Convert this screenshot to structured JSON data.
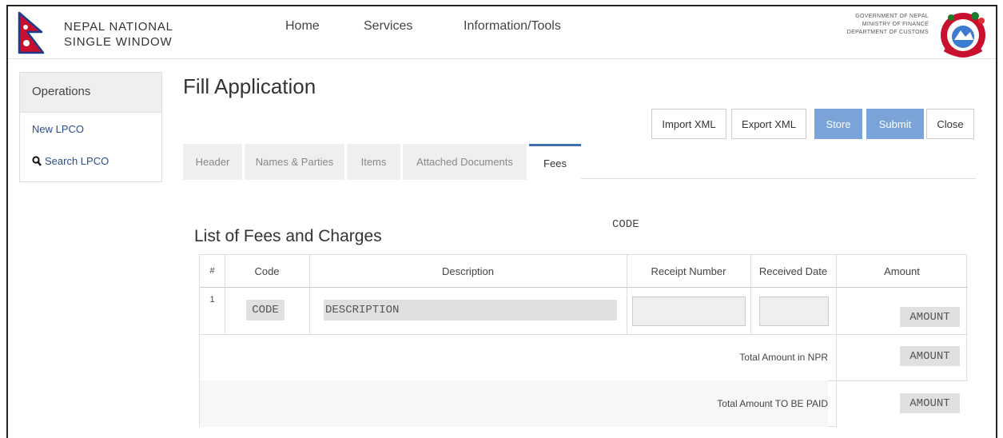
{
  "brand": {
    "line1": "NEPAL NATIONAL",
    "line2": "SINGLE WINDOW"
  },
  "nav": [
    "Home",
    "Services",
    "Information/Tools"
  ],
  "gov": {
    "line1": "GOVERNMENT OF NEPAL",
    "line2": "MINISTRY OF FINANCE",
    "line3": "DEPARTMENT OF CUSTOMS"
  },
  "sidebar": {
    "header": "Operations",
    "items": [
      {
        "label": "New LPCO"
      },
      {
        "label": "Search LPCO",
        "icon": "search-icon"
      }
    ]
  },
  "page_title": "Fill Application",
  "actions": {
    "import": "Import XML",
    "export": "Export XML",
    "store": "Store",
    "submit": "Submit",
    "close": "Close"
  },
  "tabs": [
    "Header",
    "Names & Parties",
    "Items",
    "Attached Documents",
    "Fees"
  ],
  "active_tab": "Fees",
  "code_header": "CODE",
  "list_title": "List of Fees and Charges",
  "table": {
    "columns": [
      "#",
      "Code",
      "Description",
      "Receipt Number",
      "Received Date",
      "Amount"
    ],
    "rows": [
      {
        "num": "1",
        "code": "CODE",
        "description": "DESCRIPTION",
        "amount": "AMOUNT"
      }
    ],
    "total_npr_label": "Total Amount in NPR",
    "total_npr_value": "AMOUNT",
    "total_paid_label": "Total Amount TO BE PAID",
    "total_paid_value": "AMOUNT"
  },
  "colors": {
    "accent": "#7aa3d8",
    "tab_active_border": "#3b6fb0",
    "link": "#2a4c8c"
  }
}
